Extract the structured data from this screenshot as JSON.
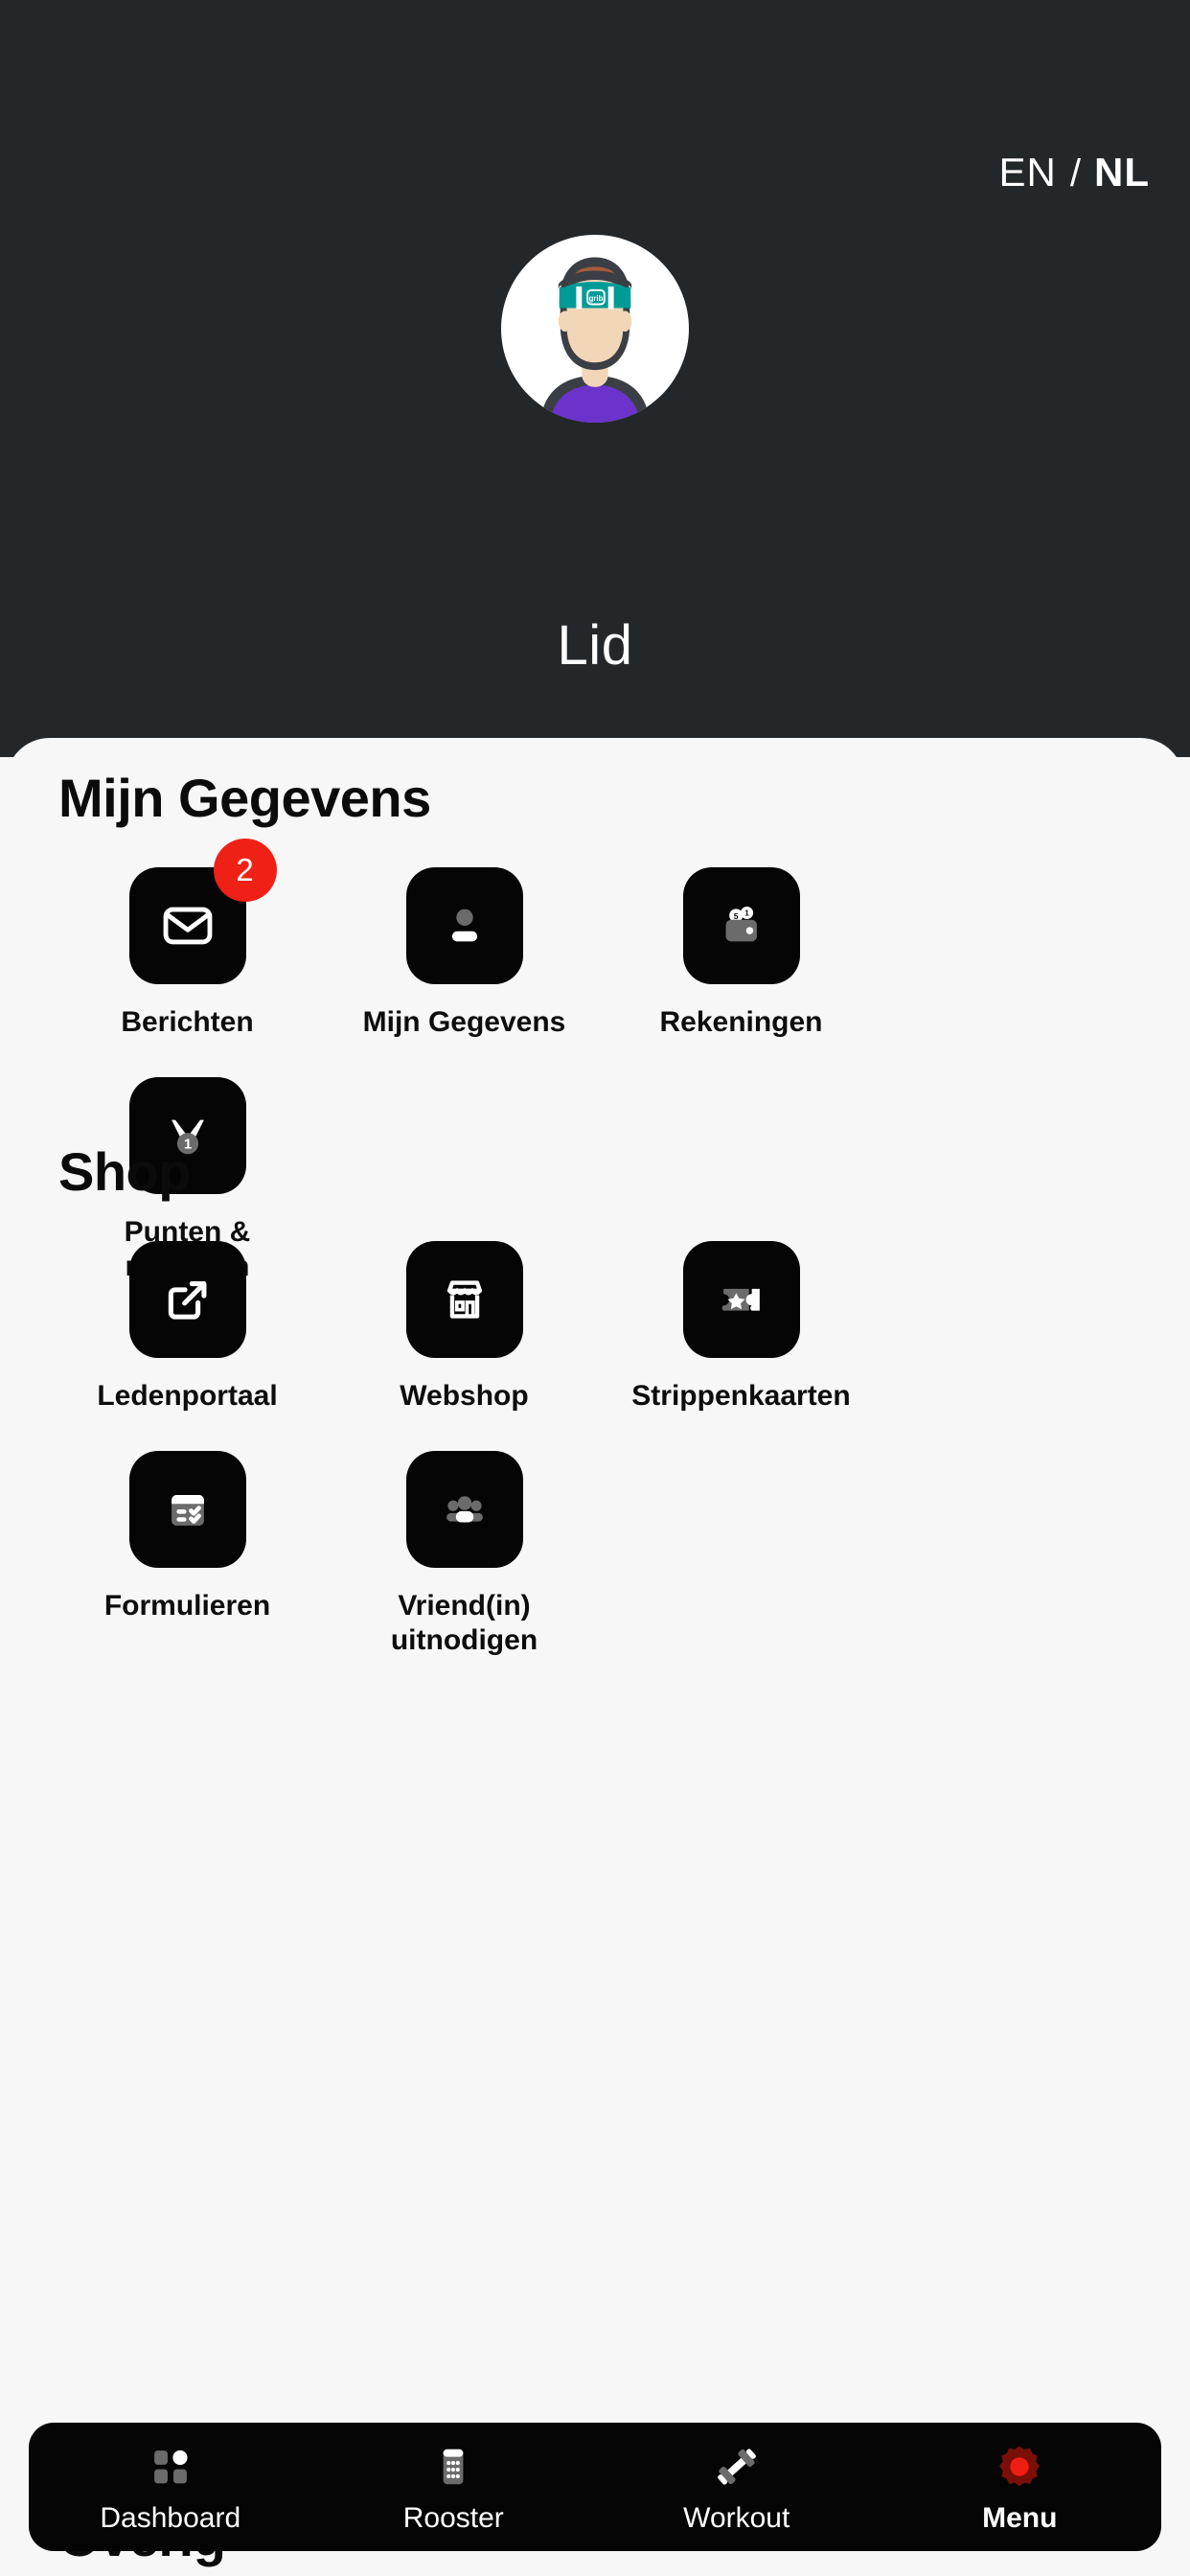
{
  "header": {
    "language": {
      "primary": "EN",
      "separator": "/",
      "secondary": "NL",
      "active": "NL"
    },
    "avatar_alt": "member-avatar",
    "avatar_brand_text": "grib",
    "profile_name": "Lid"
  },
  "sections": [
    {
      "id": "mijn-gegevens",
      "title": "Mijn Gegevens",
      "tiles": [
        {
          "id": "berichten",
          "label": "Berichten",
          "icon": "envelope-icon",
          "badge": "2"
        },
        {
          "id": "mijn-gegevens",
          "label": "Mijn Gegevens",
          "icon": "person-icon",
          "badge": null
        },
        {
          "id": "rekeningen",
          "label": "Rekeningen",
          "icon": "wallet-coins-icon",
          "badge": null,
          "coin_labels": [
            "5",
            "1"
          ]
        },
        {
          "id": "punten",
          "label": "Punten &\nmijlpalen",
          "icon": "medal-icon",
          "badge": null,
          "medal_number": "1"
        }
      ]
    },
    {
      "id": "shop",
      "title": "Shop",
      "tiles": [
        {
          "id": "ledenportaal",
          "label": "Ledenportaal",
          "icon": "external-link-icon",
          "badge": null
        },
        {
          "id": "webshop",
          "label": "Webshop",
          "icon": "storefront-icon",
          "badge": null
        },
        {
          "id": "strippenkaarten",
          "label": "Strippenkaarten",
          "icon": "ticket-star-icon",
          "badge": null
        },
        {
          "id": "formulieren",
          "label": "Formulieren",
          "icon": "checklist-icon",
          "badge": null
        },
        {
          "id": "vriend-uitnodigen",
          "label": "Vriend(in)\nuitnodigen",
          "icon": "group-people-icon",
          "badge": null
        }
      ]
    },
    {
      "id": "overig",
      "title": "Overig",
      "tiles": []
    }
  ],
  "bottom_nav": {
    "items": [
      {
        "id": "dashboard",
        "label": "Dashboard",
        "icon": "grid-squares-icon",
        "active": false
      },
      {
        "id": "rooster",
        "label": "Rooster",
        "icon": "calendar-icon",
        "active": false
      },
      {
        "id": "workout",
        "label": "Workout",
        "icon": "dumbbell-icon",
        "active": false
      },
      {
        "id": "menu",
        "label": "Menu",
        "icon": "gear-icon",
        "active": true
      }
    ]
  },
  "colors": {
    "header_bg": "#24272a",
    "sheet_bg": "#f7f7f7",
    "tile_bg": "#050505",
    "badge_red": "#ef2116",
    "accent_red": "#f01d12",
    "headband_teal": "#009b96",
    "shirt_purple": "#6b33cc",
    "icon_gray": "#6b6b6b",
    "text_dark": "#0b0b0b",
    "text_light": "#ffffff"
  }
}
